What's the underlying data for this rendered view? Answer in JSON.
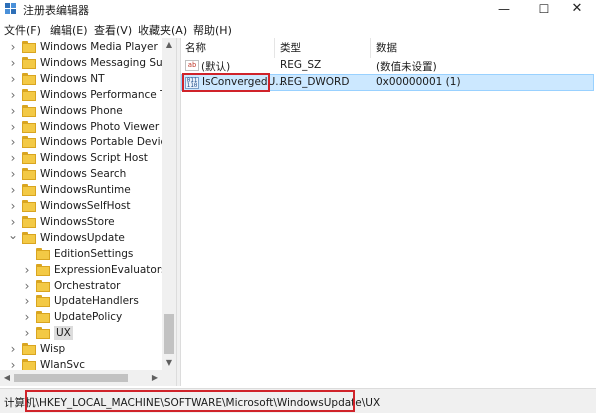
{
  "window": {
    "title": "注册表编辑器",
    "minimize_glyph": "—",
    "maximize_glyph": "☐",
    "close_glyph": "✕"
  },
  "menu": [
    {
      "label": "文件(F)"
    },
    {
      "label": "编辑(E)"
    },
    {
      "label": "查看(V)"
    },
    {
      "label": "收藏夹(A)"
    },
    {
      "label": "帮助(H)"
    }
  ],
  "tree": {
    "items": [
      {
        "label": "Windows Media Player NS",
        "level": 0,
        "expander": "collapsed"
      },
      {
        "label": "Windows Messaging Subs",
        "level": 0,
        "expander": "collapsed"
      },
      {
        "label": "Windows NT",
        "level": 0,
        "expander": "collapsed"
      },
      {
        "label": "Windows Performance Too",
        "level": 0,
        "expander": "collapsed"
      },
      {
        "label": "Windows Phone",
        "level": 0,
        "expander": "collapsed"
      },
      {
        "label": "Windows Photo Viewer",
        "level": 0,
        "expander": "collapsed"
      },
      {
        "label": "Windows Portable Devices",
        "level": 0,
        "expander": "collapsed"
      },
      {
        "label": "Windows Script Host",
        "level": 0,
        "expander": "collapsed"
      },
      {
        "label": "Windows Search",
        "level": 0,
        "expander": "collapsed"
      },
      {
        "label": "WindowsRuntime",
        "level": 0,
        "expander": "collapsed"
      },
      {
        "label": "WindowsSelfHost",
        "level": 0,
        "expander": "collapsed"
      },
      {
        "label": "WindowsStore",
        "level": 0,
        "expander": "collapsed"
      },
      {
        "label": "WindowsUpdate",
        "level": 0,
        "expander": "expanded"
      },
      {
        "label": "EditionSettings",
        "level": 1,
        "expander": "none"
      },
      {
        "label": "ExpressionEvaluators",
        "level": 1,
        "expander": "collapsed"
      },
      {
        "label": "Orchestrator",
        "level": 1,
        "expander": "collapsed"
      },
      {
        "label": "UpdateHandlers",
        "level": 1,
        "expander": "collapsed"
      },
      {
        "label": "UpdatePolicy",
        "level": 1,
        "expander": "collapsed"
      },
      {
        "label": "UX",
        "level": 1,
        "expander": "collapsed",
        "selected": true
      },
      {
        "label": "Wisp",
        "level": 0,
        "expander": "collapsed"
      },
      {
        "label": "WlanSvc",
        "level": 0,
        "expander": "collapsed"
      }
    ]
  },
  "list": {
    "headers": {
      "name": "名称",
      "type": "类型",
      "data": "数据"
    },
    "rows": [
      {
        "icon": "string-value-icon",
        "name": "(默认)",
        "type": "REG_SZ",
        "data": "(数值未设置)"
      },
      {
        "icon": "binary-value-icon",
        "name": "IsConvergedU...",
        "type": "REG_DWORD",
        "data": "0x00000001 (1)",
        "selected": true
      }
    ]
  },
  "status": {
    "path": "计算机\\HKEY_LOCAL_MACHINE\\SOFTWARE\\Microsoft\\WindowsUpdate\\UX"
  },
  "colors": {
    "selection": "#cce8ff",
    "highlight": "#d0232a",
    "folder": "#f3c945"
  }
}
